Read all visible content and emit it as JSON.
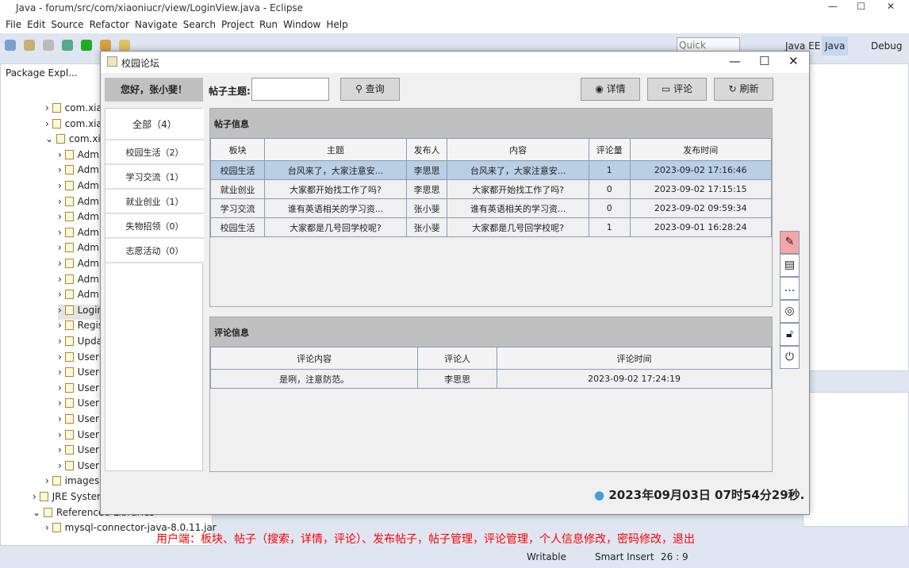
{
  "eclipse": {
    "title": "Java - forum/src/com/xiaoniucr/view/LoginView.java - Eclipse",
    "menu": [
      "File",
      "Edit",
      "Source",
      "Refactor",
      "Navigate",
      "Search",
      "Project",
      "Run",
      "Window",
      "Help"
    ],
    "quick_access": "Quick Access",
    "perspectives": [
      "Java EE",
      "Java",
      "Debug"
    ],
    "package_tab": "Package Expl...",
    "tree": [
      "com.xiaoni",
      "com.xiaoni",
      "com.xiaoni",
      "AdminC",
      "AdminN",
      "AdminP",
      "AdminP",
      "AdminP",
      "AdminP",
      "AdminP",
      "AdminU",
      "AdminU",
      "AdminU",
      "LoginVi",
      "Registe",
      "Update",
      "UserCo",
      "UserCo",
      "UserInd",
      "UserPo",
      "UserPo",
      "UserPo",
      "UserPo",
      "UserUp",
      "images",
      "JRE System Lib",
      "Referenced Libraries",
      "mysql-connector-java-8.0.11.jar"
    ],
    "status": {
      "writable": "Writable",
      "insert": "Smart Insert",
      "position": "26 : 9"
    },
    "note": "用户端：板块、帖子（搜索，详情，评论）、发布帖子，帖子管理，评论管理，个人信息修改，密码修改，退出"
  },
  "dialog": {
    "title": "校园论坛",
    "greeting": "您好，张小斐！",
    "categories": [
      "全部（4）",
      "校园生活（2）",
      "学习交流（1）",
      "就业创业（1）",
      "失物招领（0）",
      "志愿活动（0）"
    ],
    "search_label": "帖子主题:",
    "search_value": "",
    "query": "查询",
    "detail": "详情",
    "comment": "评论",
    "refresh": "刷新",
    "posts_title": "帖子信息",
    "post_columns": [
      "板块",
      "主题",
      "发布人",
      "内容",
      "评论量",
      "发布时间"
    ],
    "posts": [
      [
        "校园生活",
        "台风来了，大家注意安...",
        "李思思",
        "台风来了，大家注意安...",
        "1",
        "2023-09-02 17:16:46"
      ],
      [
        "就业创业",
        "大家都开始找工作了吗?",
        "李思思",
        "大家都开始找工作了吗?",
        "0",
        "2023-09-02 17:15:15"
      ],
      [
        "学习交流",
        "谁有英语相关的学习资...",
        "张小斐",
        "谁有英语相关的学习资...",
        "0",
        "2023-09-02 09:59:34"
      ],
      [
        "校园生活",
        "大家都是几号回学校呢?",
        "张小斐",
        "大家都是几号回学校呢?",
        "1",
        "2023-09-01 16:28:24"
      ]
    ],
    "comments_title": "评论信息",
    "comment_columns": [
      "评论内容",
      "评论人",
      "评论时间"
    ],
    "comments": [
      [
        "是咧，注意防范。",
        "李思思",
        "2023-09-02 17:24:19"
      ]
    ],
    "clock": "2023年09月03日 07时54分29秒.",
    "side_icons": [
      "edit-post-icon",
      "document-icon",
      "comment-icon",
      "user-icon",
      "lock-icon",
      "power-icon"
    ],
    "accent_active": "#f4a6a6"
  }
}
